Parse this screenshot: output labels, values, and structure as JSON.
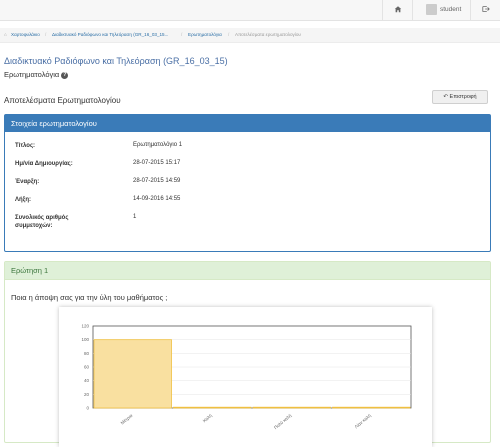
{
  "topbar": {
    "home_icon": "home-icon",
    "user_name": "student",
    "logout_icon": "logout-icon"
  },
  "breadcrumb": {
    "items": [
      "Χαρτοφυλάκιο",
      "Διαδικτυακό Ραδιόφωνο και Τηλεόραση (GR_16_03_15...",
      "Ερωτηματολόγια",
      "Αποτελέσματα ερωτηματολογίου"
    ]
  },
  "page": {
    "course_title": "Διαδικτυακό Ραδιόφωνο και Τηλεόραση (GR_16_03_15)",
    "subtitle": "Ερωτηματολόγια",
    "results_heading": "Αποτελέσματα Ερωτηματολογίου",
    "back_button": "Επιστροφή"
  },
  "info": {
    "title": "Στοιχεία ερωτηματολογίου",
    "rows": [
      {
        "label": "Τίτλος:",
        "value": "Ερωτηματολόγιο 1"
      },
      {
        "label": "Ημ/νία Δημιουργίας:",
        "value": "28-07-2015 15:17"
      },
      {
        "label": "Έναρξη:",
        "value": "28-07-2015 14:59"
      },
      {
        "label": "Λήξη:",
        "value": "14-09-2016 14:55"
      },
      {
        "label": "Συνολικός αριθμός συμμετοχών:",
        "value": "1"
      }
    ]
  },
  "question": {
    "title": "Ερώτηση 1",
    "text": "Ποια η άποψη σας για την ύλη του μαθήματος ;"
  },
  "chart_data": {
    "type": "bar",
    "categories": [
      "Μέτρια",
      "Καλή",
      "Πολύ καλή",
      "Λίαν καλή"
    ],
    "values": [
      100,
      0,
      0,
      0
    ],
    "ylim": [
      0,
      120
    ],
    "yticks": [
      0,
      20,
      40,
      60,
      80,
      100,
      120
    ],
    "bar_color": "#f9e0a0",
    "bar_border": "#f0c040",
    "grid": true
  },
  "colors": {
    "primary": "#3a7bb8",
    "success_bg": "#dff0d8",
    "title_link": "#4a6fa5"
  }
}
